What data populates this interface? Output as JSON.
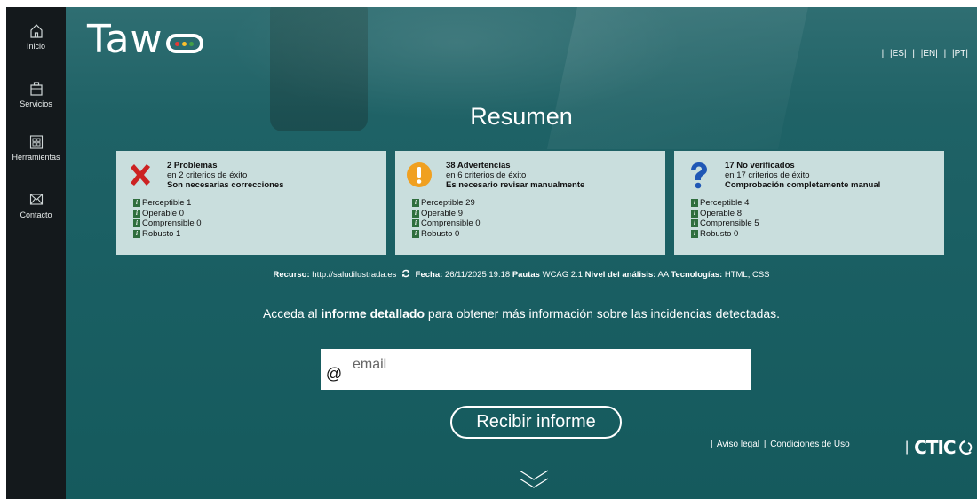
{
  "sidebar": {
    "items": [
      {
        "label": "Inicio",
        "icon": "home-icon"
      },
      {
        "label": "Servicios",
        "icon": "briefcase-icon"
      },
      {
        "label": "Herramientas",
        "icon": "grid-icon"
      },
      {
        "label": "Contacto",
        "icon": "mail-icon"
      }
    ]
  },
  "header": {
    "logo_text": "Taw",
    "languages": [
      "|ES|",
      "|EN|",
      "|PT|"
    ],
    "separator": "|"
  },
  "main": {
    "title": "Resumen",
    "cards": [
      {
        "icon": "red-cross-icon",
        "heading": "2 Problemas",
        "criteria": "en 2 criterios de éxito",
        "note": "Son necesarias correcciones",
        "items": [
          "Perceptible 1",
          "Operable 0",
          "Comprensible 0",
          "Robusto 1"
        ]
      },
      {
        "icon": "warning-icon",
        "heading": "38 Advertencias",
        "criteria": "en 6 criterios de éxito",
        "note": "Es necesario revisar manualmente",
        "items": [
          "Perceptible 29",
          "Operable 9",
          "Comprensible 0",
          "Robusto 0"
        ]
      },
      {
        "icon": "question-icon",
        "heading": "17 No verificados",
        "criteria": "en 17 criterios de éxito",
        "note": "Comprobación completamente manual",
        "items": [
          "Perceptible 4",
          "Operable 8",
          "Comprensible 5",
          "Robusto 0"
        ]
      }
    ],
    "meta": {
      "resource_label": "Recurso:",
      "resource_value": "http://saludilustrada.es",
      "date_label": "Fecha:",
      "date_value": "26/11/2025 19:18",
      "guidelines_label": "Pautas",
      "guidelines_value": "WCAG 2.1",
      "level_label": "Nivel del análisis:",
      "level_value": "AA",
      "tech_label": "Tecnologías:",
      "tech_value": "HTML, CSS"
    },
    "access": {
      "before": "Acceda al",
      "bold": "informe detallado",
      "after": "para obtener más información sobre las incidencias detectadas."
    },
    "email": {
      "at_symbol": "@",
      "placeholder": "email",
      "value": ""
    },
    "submit_label": "Recibir informe"
  },
  "footer": {
    "legal": "Aviso legal",
    "terms": "Condiciones de Uso",
    "brand": "CTIC"
  },
  "colors": {
    "sidebar_bg": "#14191c",
    "main_bg": "#1a5f63",
    "card_bg": "#c9dedd",
    "error_red": "#cc2222",
    "warning_orange": "#f0a020",
    "question_blue": "#1f57b5"
  }
}
